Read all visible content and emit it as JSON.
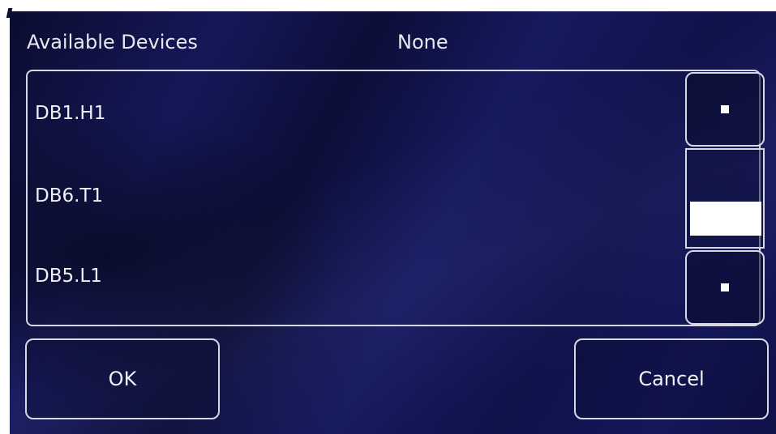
{
  "header": {
    "label": "Available Devices",
    "selected_value": "None"
  },
  "device_list": {
    "items": [
      {
        "label": "DB1.H1"
      },
      {
        "label": "DB6.T1"
      },
      {
        "label": "DB5.L1"
      }
    ],
    "scroll": {
      "up_icon": "square-dot-icon",
      "down_icon": "square-dot-icon"
    }
  },
  "buttons": {
    "ok_label": "OK",
    "cancel_label": "Cancel"
  },
  "colors": {
    "background": "#141759",
    "border": "#d8d8e4",
    "text": "#f0f0f6"
  }
}
